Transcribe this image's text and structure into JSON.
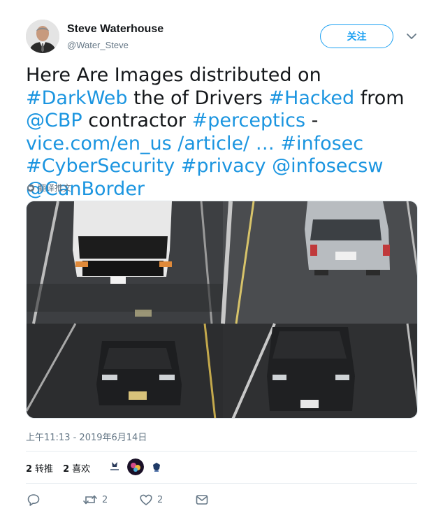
{
  "user": {
    "name": "Steve Waterhouse",
    "handle": "@Water_Steve"
  },
  "follow_label": "关注",
  "tweet": {
    "segments": [
      {
        "text": "Here Are Images distributed on ",
        "link": false
      },
      {
        "text": "#DarkWeb",
        "link": true
      },
      {
        "text": " the  of Drivers ",
        "link": false
      },
      {
        "text": "#Hacked",
        "link": true
      },
      {
        "text": " from ",
        "link": false
      },
      {
        "text": "@CBP",
        "link": true
      },
      {
        "text": " contractor ",
        "link": false
      },
      {
        "text": "#perceptics",
        "link": true
      },
      {
        "text": " -  ",
        "link": false
      },
      {
        "text": "vice.com/en_us /article/    …",
        "link": true
      },
      {
        "text": " ",
        "link": false
      },
      {
        "text": "#infosec",
        "link": true
      },
      {
        "text": " ",
        "link": false
      },
      {
        "text": "#CyberSecurity",
        "link": true
      },
      {
        "text": " ",
        "link": false
      },
      {
        "text": "#privacy",
        "link": true
      },
      {
        "text": " ",
        "link": false
      },
      {
        "text": "@infosecsw",
        "link": true
      },
      {
        "text": " ",
        "link": false
      },
      {
        "text": "@CanBorder",
        "link": true
      }
    ]
  },
  "translate_label": "翻译推文",
  "timestamp": "上午11:13 - 2019年6月14日",
  "stats": {
    "retweets_count": "2",
    "retweets_label": "转推",
    "likes_count": "2",
    "likes_label": "喜欢"
  },
  "actions": {
    "retweet_count": "2",
    "like_count": "2"
  },
  "colors": {
    "link": "#1b95e0",
    "accent": "#1da1f2",
    "muted": "#657786"
  }
}
